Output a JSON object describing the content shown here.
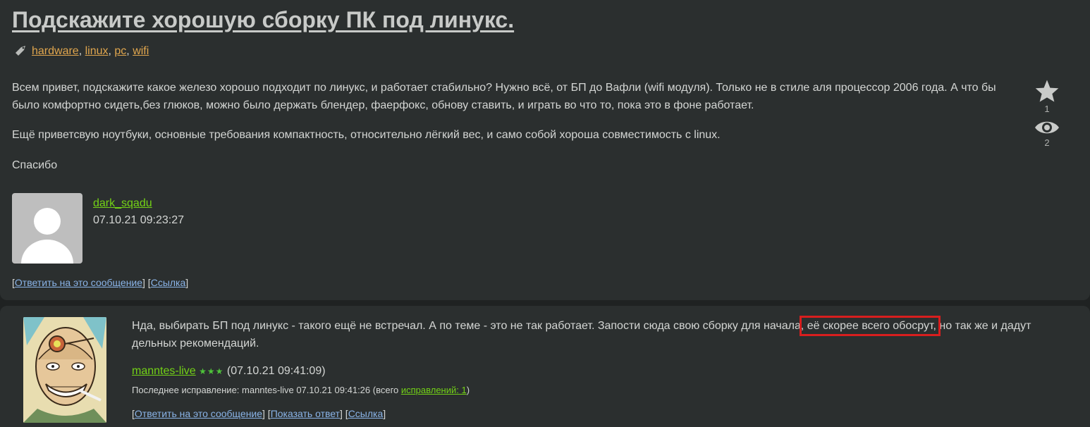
{
  "topic": {
    "title": "Подскажите хорошую сборку ПК под линукс.",
    "tags": [
      "hardware",
      "linux",
      "pc",
      "wifi"
    ],
    "tag_sep": ", ",
    "paragraphs": [
      "Всем привет, подскажите какое железо хорошо подходит по линукс, и работает стабильно? Нужно всё, от БП до Вафли (wifi модуля). Только не в стиле аля процессор 2006 года. А что бы было комфортно сидеть,без глюков, можно было держать блендер, фаерфокс, обнову ставить, и играть во что то, пока это в фоне работает.",
      "Ещё приветсвую ноутбуки, основные требования компактность, относительно лёгкий вес, и само собой хороша совместимость с linux.",
      "Спасибо"
    ],
    "favorites_count": "1",
    "watch_count": "2",
    "author": "dark_sqadu",
    "date": "07.10.21 09:23:27",
    "actions": {
      "reply": "Ответить на это сообщение",
      "link": "Ссылка"
    }
  },
  "comment": {
    "text_before": "Нда, выбирать БП под линукс - такого ещё не встречал. А по теме - это не так работает. Запости сюда свою сборку для начала,",
    "text_highlight": " её скорее всего обосрут,",
    "text_after": " но так же и дадут дельных рекомендаций.",
    "author": "manntes-live",
    "stars": "★★★",
    "date": "(07.10.21 09:41:09)",
    "edited_prefix": "Последнее исправление: manntes-live 07.10.21 09:41:26 (всего ",
    "edited_link": "исправлений: 1",
    "edited_suffix": ")",
    "actions": {
      "reply": "Ответить на это сообщение",
      "show_answer": "Показать ответ",
      "link": "Ссылка"
    }
  },
  "colors": {
    "background": "#1f2222",
    "panel": "#2b2f2f",
    "tag_link": "#e0a64e",
    "author_link": "#73d216",
    "action_link": "#8ab4e8",
    "highlight_box": "#d81e1e"
  }
}
